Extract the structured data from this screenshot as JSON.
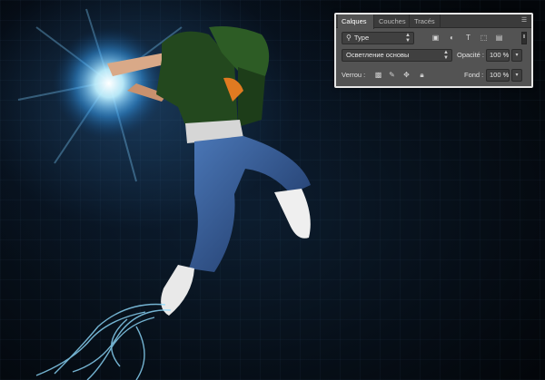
{
  "panel": {
    "tabs": [
      {
        "label": "Calques",
        "active": true
      },
      {
        "label": "Couches",
        "active": false
      },
      {
        "label": "Tracés",
        "active": false
      }
    ],
    "filter": {
      "value": "Type",
      "icons": [
        "pixel-layer-filter-icon",
        "adjustment-layer-filter-icon",
        "type-layer-filter-icon",
        "shape-layer-filter-icon",
        "smart-object-filter-icon"
      ]
    },
    "blend_mode": "Осветление основы",
    "opacity": {
      "label": "Opacité :",
      "value": "100 %"
    },
    "lock": {
      "label": "Verrou :",
      "icons": [
        "lock-transparent-pixels-icon",
        "lock-image-pixels-icon",
        "lock-position-icon",
        "lock-all-icon"
      ]
    },
    "fill": {
      "label": "Fond :",
      "value": "100 %"
    }
  },
  "colors": {
    "panel_bg": "#535353",
    "tab_bar": "#3b3b3b",
    "glow": "#9fe6ff",
    "hoodie": "#234a1f",
    "jeans": "#2c4e86"
  }
}
